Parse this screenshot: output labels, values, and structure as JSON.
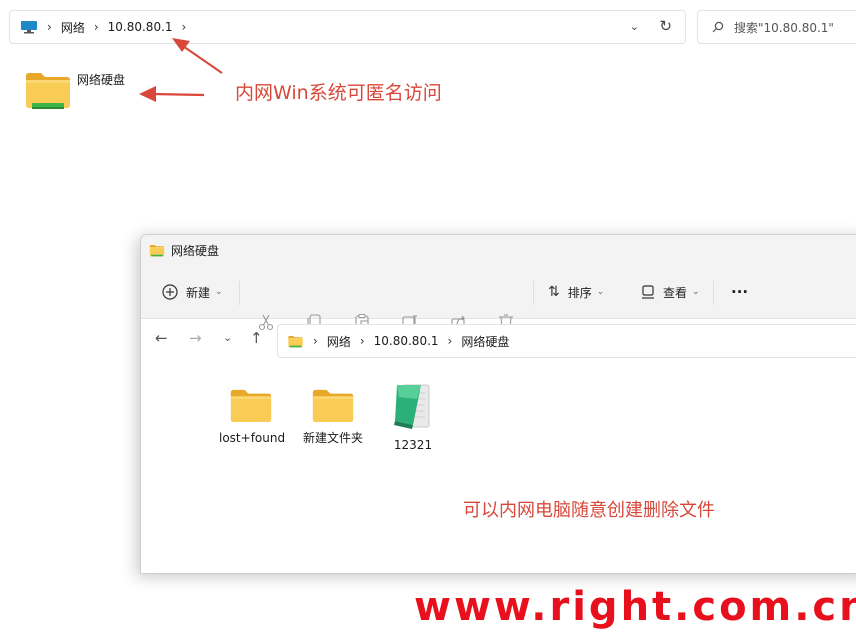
{
  "top_window": {
    "breadcrumb": [
      "网络",
      "10.80.80.1"
    ],
    "search_placeholder": "搜索\"10.80.80.1\"",
    "items": [
      {
        "label": "网络硬盘",
        "icon": "network-drive-folder-icon"
      }
    ]
  },
  "annotations": {
    "top": "内网Win系统可匿名访问",
    "bottom": "可以内网电脑随意创建删除文件"
  },
  "front_window": {
    "title": "网络硬盘",
    "toolbar": {
      "new_label": "新建",
      "sort_label": "排序",
      "view_label": "查看",
      "more_label": "···"
    },
    "breadcrumb": [
      "网络",
      "10.80.80.1",
      "网络硬盘"
    ],
    "items": [
      {
        "label": "lost+found",
        "icon": "folder-icon"
      },
      {
        "label": "新建文件夹",
        "icon": "folder-icon"
      },
      {
        "label": "12321",
        "icon": "notepad-file-icon"
      }
    ]
  },
  "watermark": "www.right.com.cn",
  "colors": {
    "annotation": "#d9473a",
    "watermark": "#e8101c",
    "folder": "#f7c948"
  }
}
